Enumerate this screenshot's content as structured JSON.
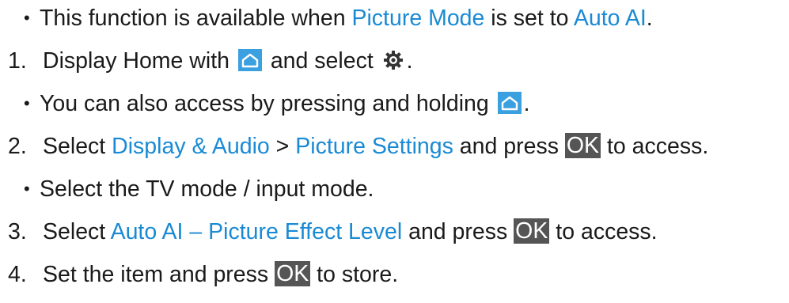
{
  "lines": [
    {
      "type": "bullet",
      "bullet": "•",
      "t1": "This function is available when ",
      "link1": "Picture Mode",
      "t2": " is set to ",
      "link2": "Auto AI",
      "t3": "."
    },
    {
      "type": "step",
      "num": "1.",
      "t1": "Display Home with ",
      "t2": " and select ",
      "t3": ".",
      "icon1": "home-icon",
      "icon2": "gear-icon"
    },
    {
      "type": "bullet",
      "bullet": "•",
      "t1": "You can also access by pressing and holding ",
      "t2": ".",
      "icon1": "home-icon"
    },
    {
      "type": "step",
      "num": "2.",
      "t1": "Select ",
      "link1": "Display & Audio",
      "t2": " > ",
      "link2": "Picture Settings",
      "t3": " and press ",
      "ok": "OK",
      "t4": " to access."
    },
    {
      "type": "bullet",
      "bullet": "•",
      "t1": "Select the TV mode / input mode."
    },
    {
      "type": "step",
      "num": "3.",
      "t1": "Select ",
      "link1": "Auto AI – Picture Effect Level",
      "t2": " and press ",
      "ok": "OK",
      "t3": " to access."
    },
    {
      "type": "step",
      "num": "4.",
      "t1": "Set the item and press ",
      "ok": "OK",
      "t2": " to store."
    }
  ],
  "colors": {
    "link": "#1a8ad4",
    "ok_bg": "#555555",
    "ok_text": "#ffffff",
    "home_icon": "#3aa0e0",
    "text": "#1a1a1a"
  }
}
